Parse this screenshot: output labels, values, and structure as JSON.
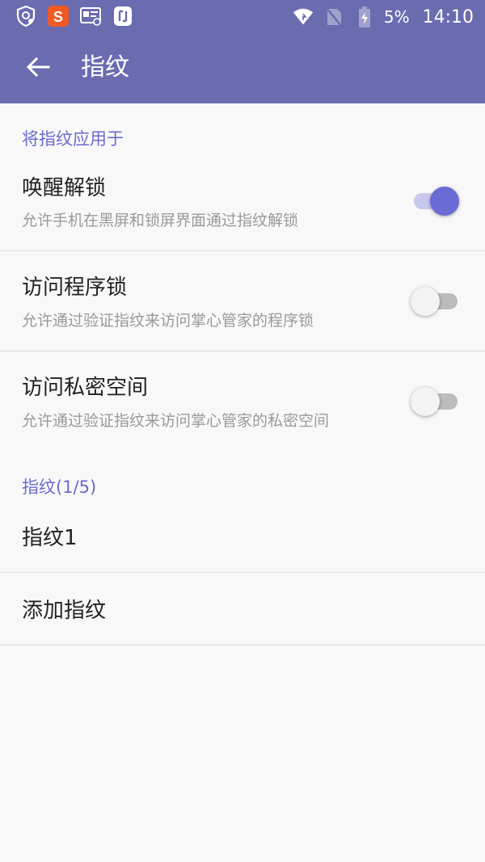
{
  "status_bar": {
    "icons_left": [
      "shield-icon",
      "sogou-icon",
      "id-card-icon",
      "app-icon"
    ],
    "battery_percent": "5%",
    "time": "14:10"
  },
  "toolbar": {
    "title": "指纹",
    "bg_color": "#6b6bb0"
  },
  "section_apply": {
    "header": "将指纹应用于",
    "items": [
      {
        "title": "唤醒解锁",
        "subtitle": "允许手机在黑屏和锁屏界面通过指纹解锁",
        "enabled": true
      },
      {
        "title": "访问程序锁",
        "subtitle": "允许通过验证指纹来访问掌心管家的程序锁",
        "enabled": false
      },
      {
        "title": "访问私密空间",
        "subtitle": "允许通过验证指纹来访问掌心管家的私密空间",
        "enabled": false
      }
    ]
  },
  "section_fingerprints": {
    "header": "指纹(1/5)",
    "items": [
      "指纹1",
      "添加指纹"
    ]
  },
  "colors": {
    "accent": "#6b6bd0",
    "switch_on": "#6b6bd6"
  }
}
